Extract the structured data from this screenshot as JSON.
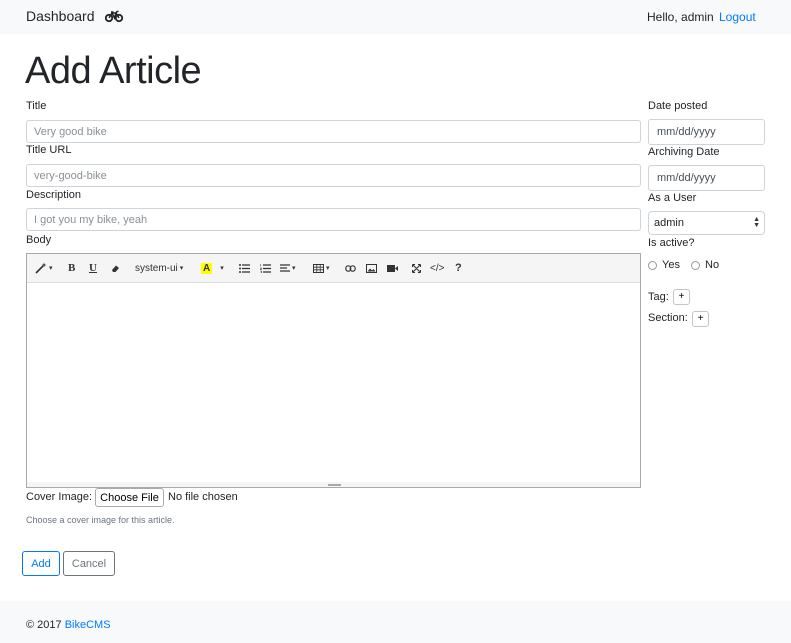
{
  "navbar": {
    "brand": "Dashboard",
    "brand_icon": "bicycle-icon",
    "greeting": "Hello, admin",
    "logout": "Logout"
  },
  "page": {
    "title": "Add Article"
  },
  "form": {
    "title": {
      "label": "Title",
      "placeholder": "Very good bike"
    },
    "title_url": {
      "label": "Title URL",
      "placeholder": "very-good-bike"
    },
    "description": {
      "label": "Description",
      "placeholder": "I got you my bike, yeah"
    },
    "body": {
      "label": "Body",
      "toolbar": {
        "font": "system-ui",
        "icons": [
          "magic-icon",
          "bold-icon",
          "underline-icon",
          "eraser-icon",
          "font-name-dropdown",
          "text-color-icon",
          "unordered-list-icon",
          "ordered-list-icon",
          "paragraph-align-icon",
          "table-icon",
          "link-icon",
          "picture-icon",
          "video-icon",
          "fullscreen-icon",
          "code-view-icon",
          "help-icon"
        ],
        "bold": "B",
        "underline": "U",
        "color": "A",
        "help": "?"
      }
    },
    "cover": {
      "label": "Cover Image:",
      "button": "Choose File",
      "status": "No file chosen",
      "help": "Choose a cover image for this article."
    },
    "date_posted": {
      "label": "Date posted",
      "value": "mm/dd/yyyy"
    },
    "archiving_date": {
      "label": "Archiving Date",
      "value": "mm/dd/yyyy"
    },
    "user": {
      "label": "As a User",
      "selected": "admin"
    },
    "active": {
      "label": "Is active?",
      "yes": "Yes",
      "no": "No"
    },
    "tag": {
      "label": "Tag:",
      "button": "+"
    },
    "section": {
      "label": "Section:",
      "button": "+"
    },
    "add_button": "Add",
    "cancel_button": "Cancel"
  },
  "footer": {
    "copyright": "© 2017",
    "link": "BikeCMS"
  },
  "colors": {
    "accent": "#007bff",
    "navbar_bg": "#f8f9fa",
    "secondary": "#6c757d"
  }
}
